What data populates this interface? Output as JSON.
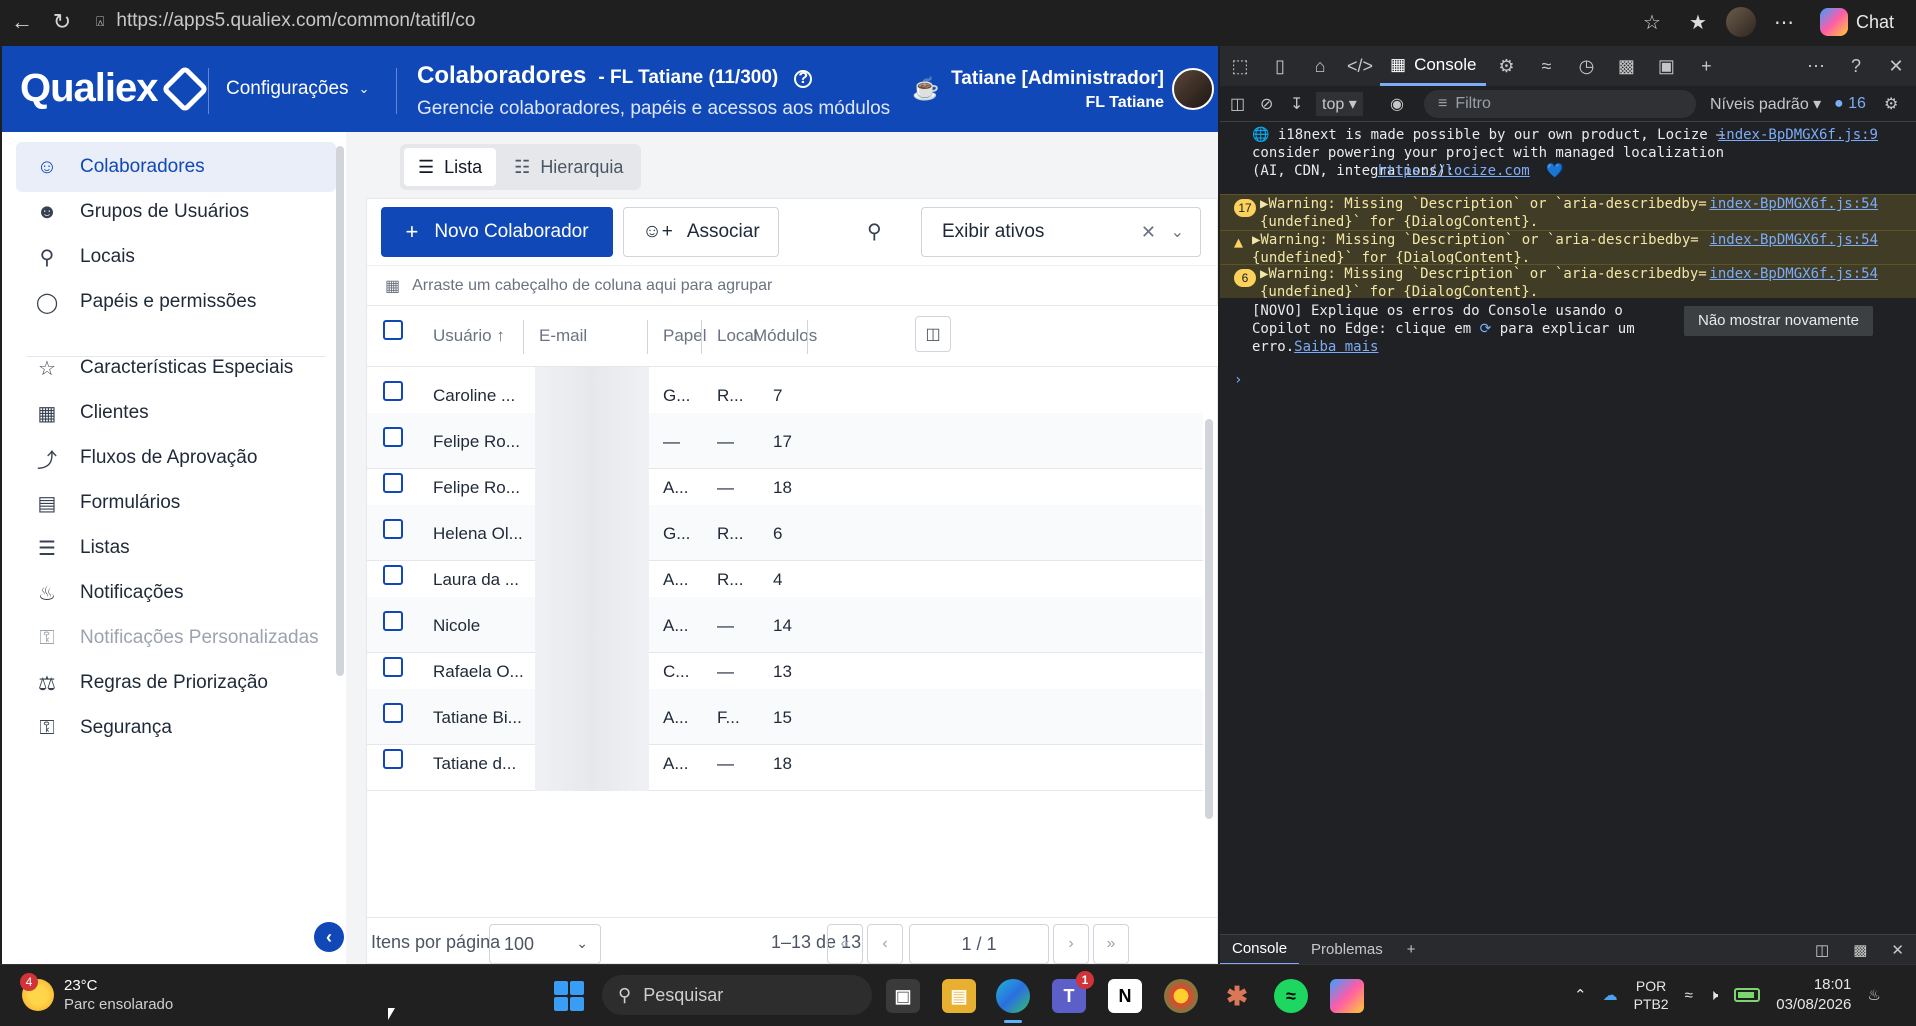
{
  "browser": {
    "url": "https://apps5.qualiex.com/common/tatifl/co",
    "chat_label": "Chat"
  },
  "app": {
    "logo": "Qualiex",
    "config_menu": "Configurações",
    "page_title": "Colaboradores",
    "page_subtitle": "- FL Tatiane (11/300)",
    "page_description": "Gerencie colaboradores, papéis e acessos aos módulos",
    "user_name": "Tatiane [Administrador]",
    "user_org": "FL Tatiane",
    "brand_color": "#1048b8"
  },
  "sidebar": {
    "items": [
      {
        "label": "Colaboradores",
        "icon": "users-icon"
      },
      {
        "label": "Grupos de Usuários",
        "icon": "user-group-icon"
      },
      {
        "label": "Locais",
        "icon": "map-pin-icon"
      },
      {
        "label": "Papéis e permissões",
        "icon": "shield-icon"
      },
      {
        "label": "Características Especiais",
        "icon": "star-icon"
      },
      {
        "label": "Clientes",
        "icon": "building-icon"
      },
      {
        "label": "Fluxos de Aprovação",
        "icon": "flow-icon"
      },
      {
        "label": "Formulários",
        "icon": "form-icon"
      },
      {
        "label": "Listas",
        "icon": "list-icon"
      },
      {
        "label": "Notificações",
        "icon": "bell-icon"
      },
      {
        "label": "Notificações Personalizadas",
        "icon": "lock-icon"
      },
      {
        "label": "Regras de Priorização",
        "icon": "scale-icon"
      },
      {
        "label": "Segurança",
        "icon": "lock-icon"
      }
    ]
  },
  "main": {
    "tabs": [
      {
        "label": "Lista"
      },
      {
        "label": "Hierarquia"
      }
    ],
    "new_button": "Novo Colaborador",
    "associate_button": "Associar",
    "filter_value": "Exibir ativos",
    "group_hint": "Arraste um cabeçalho de coluna aqui para agrupar",
    "columns": {
      "user": "Usuário",
      "email": "E-mail",
      "role": "Papel",
      "local": "Local",
      "modules": "Módulos"
    },
    "rows": [
      {
        "user": "Caroline ...",
        "role": "G...",
        "local": "R...",
        "modules": "7"
      },
      {
        "user": "Felipe Ro...",
        "role": "—",
        "local": "—",
        "modules": "17"
      },
      {
        "user": "Felipe Ro...",
        "role": "A...",
        "local": "—",
        "modules": "18"
      },
      {
        "user": "Helena Ol...",
        "role": "G...",
        "local": "R...",
        "modules": "6"
      },
      {
        "user": "Laura da ...",
        "role": "A...",
        "local": "R...",
        "modules": "4"
      },
      {
        "user": "Nicole",
        "role": "A...",
        "local": "—",
        "modules": "14"
      },
      {
        "user": "Rafaela O...",
        "role": "C...",
        "local": "—",
        "modules": "13"
      },
      {
        "user": "Tatiane Bi...",
        "role": "A...",
        "local": "F...",
        "modules": "15"
      },
      {
        "user": "Tatiane d...",
        "role": "A...",
        "local": "—",
        "modules": "18"
      }
    ],
    "pager": {
      "per_page_label": "Itens por página",
      "per_page": "100",
      "range": "1–13 de 13",
      "pages": "1 / 1"
    }
  },
  "devtools": {
    "active_tab": "Console",
    "context": "top",
    "filter_placeholder": "Filtro",
    "levels": "Níveis padrão",
    "issues_count": "16",
    "messages": [
      {
        "text": "🌐 i18next is made possible by our own product, Locize — consider powering your project with managed localization (AI, CDN, integrations):",
        "link_text": "https://locize.com",
        "heart": "💙",
        "source": "index-BpDMGX6f.js:9"
      },
      {
        "count": "17",
        "text": "▶Warning: Missing `Description` or `aria-describedby={undefined}` for {DialogContent}.",
        "source": "index-BpDMGX6f.js:54"
      },
      {
        "count": "▲",
        "text": "▶Warning: Missing `Description` or `aria-describedby={undefined}` for {DialogContent}.",
        "source": "index-BpDMGX6f.js:54"
      },
      {
        "count": "6",
        "text": "▶Warning: Missing `Description` or `aria-describedby={undefined}` for {DialogContent}.",
        "source": "index-BpDMGX6f.js:54"
      }
    ],
    "copilot_note": "[NOVO] Explique os erros do Console usando o Copilot no Edge: clique em",
    "copilot_note_2": "para explicar um erro.",
    "learn_more": "Saiba mais",
    "dont_show": "Não mostrar novamente",
    "drawer_tabs": [
      "Console",
      "Problemas"
    ]
  },
  "taskbar": {
    "weather_badge": "4",
    "temperature": "23°C",
    "weather_desc": "Parc ensolarado",
    "search_placeholder": "Pesquisar",
    "teams_badge": "1",
    "lang_1": "POR",
    "lang_2": "PTB2",
    "time": "18:01",
    "date": "03/08/2026"
  }
}
